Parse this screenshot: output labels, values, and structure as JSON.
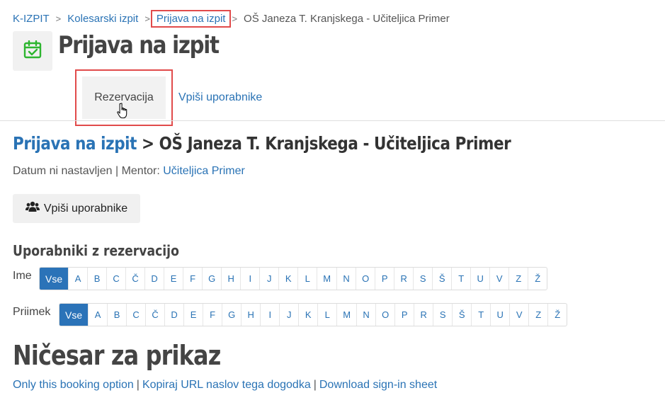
{
  "breadcrumb": {
    "items": [
      "K-IZPIT",
      "Kolesarski izpit",
      "Prijava na izpit"
    ],
    "current": "OŠ Janeza T. Kranjskega - Učiteljica Primer",
    "separator": ">"
  },
  "header": {
    "icon": "calendar-check-icon",
    "title": "Prijava na izpit"
  },
  "tabs": [
    {
      "label": "Rezervacija",
      "active": true
    },
    {
      "label": "Vpiši uporabnike",
      "active": false
    }
  ],
  "section": {
    "title_link": "Prijava na izpit",
    "title_rest": "> OŠ Janeza T. Kranjskega - Učiteljica Primer",
    "meta_prefix": "Datum ni nastavljen | Mentor: ",
    "mentor": "Učiteljica Primer"
  },
  "enroll_button": {
    "icon": "users-icon",
    "label": "Vpiši uporabnike"
  },
  "users_heading": "Uporabniki z rezervacijo",
  "filters": {
    "first_name_label": "Ime",
    "last_name_label": "Priimek",
    "all_label": "Vse",
    "letters": [
      "A",
      "B",
      "C",
      "Č",
      "D",
      "E",
      "F",
      "G",
      "H",
      "I",
      "J",
      "K",
      "L",
      "M",
      "N",
      "O",
      "P",
      "R",
      "S",
      "Š",
      "T",
      "U",
      "V",
      "Z",
      "Ž"
    ]
  },
  "empty_title": "Ničesar za prikaz",
  "footer_links": [
    "Only this booking option",
    "Kopiraj URL naslov tega dogodka",
    "Download sign-in sheet"
  ],
  "colors": {
    "link": "#2a73b5",
    "active_filter": "#2b73b8",
    "highlight": "#e14b4b",
    "icon_green": "#2db52f"
  }
}
